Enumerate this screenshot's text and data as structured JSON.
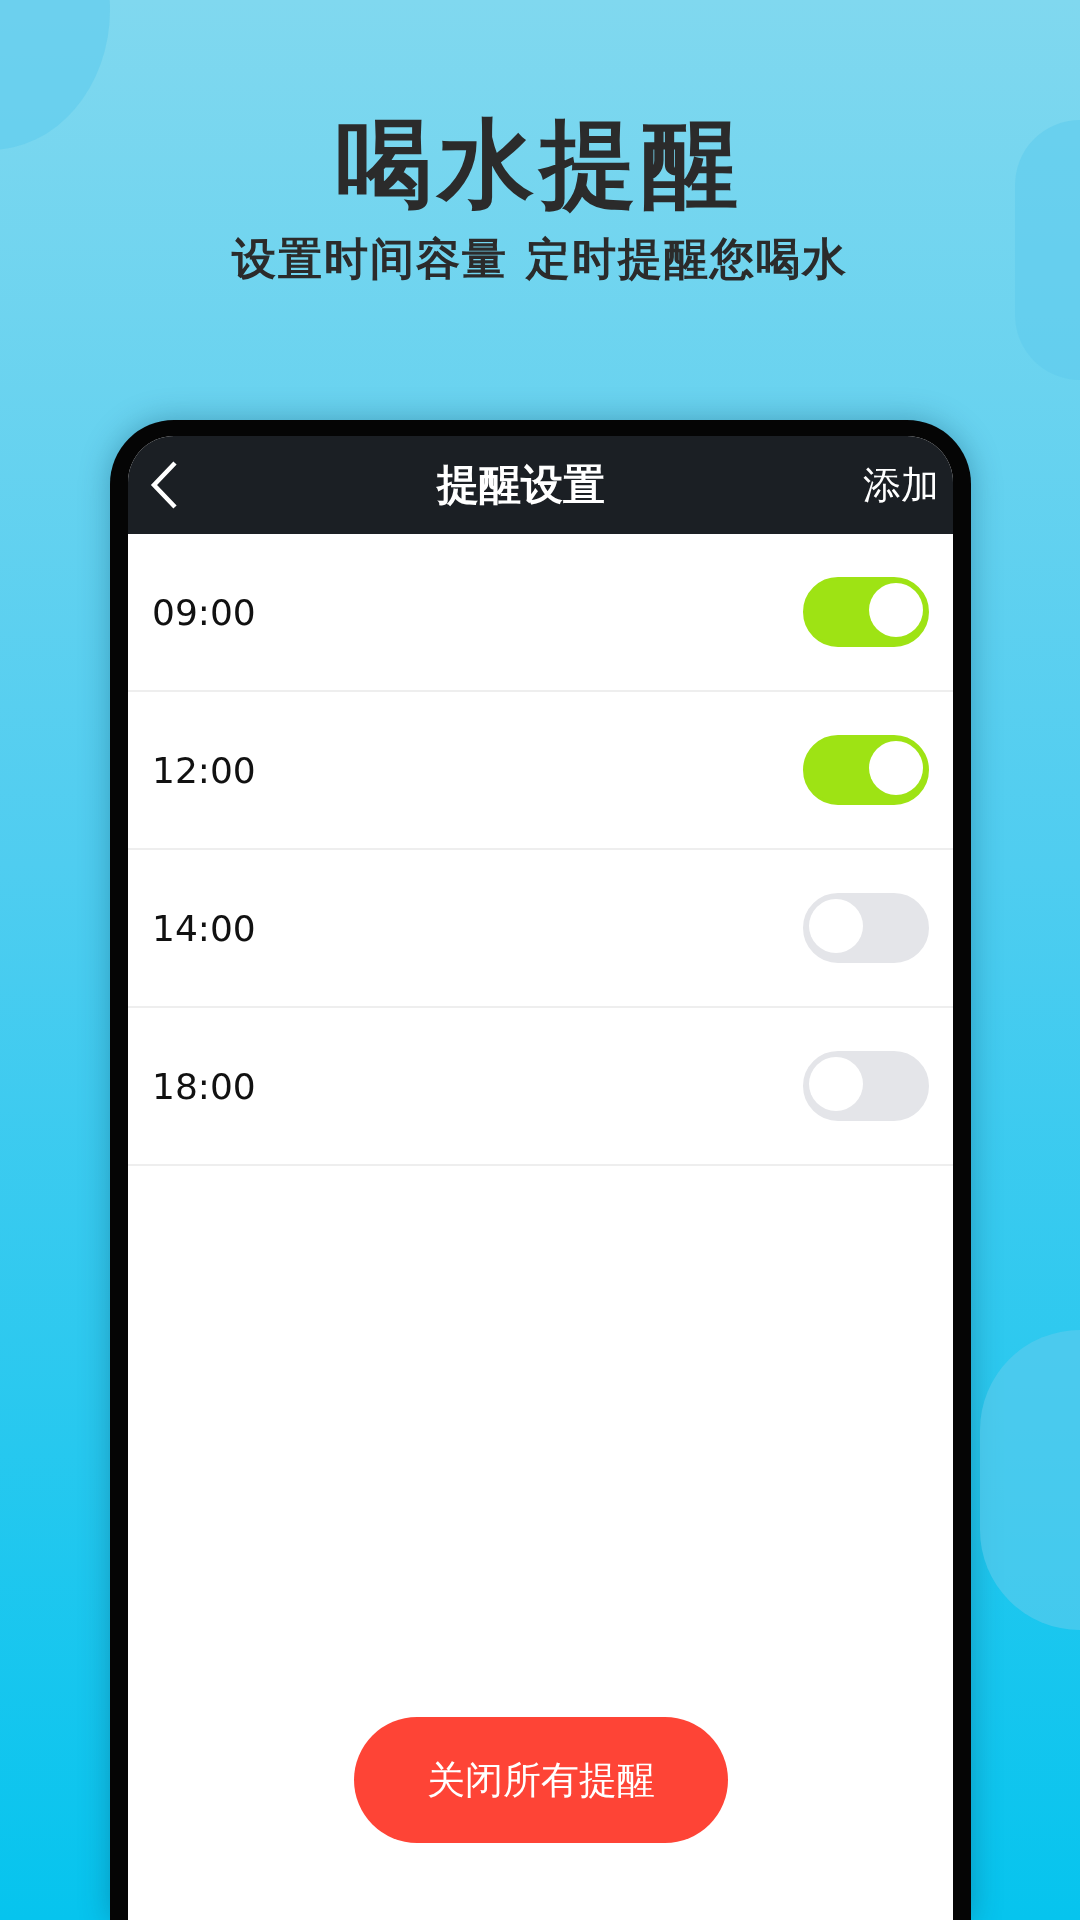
{
  "headline": "喝水提醒",
  "tagline": "设置时间容量 定时提醒您喝水",
  "screen": {
    "title": "提醒设置",
    "action": "添加",
    "reminders": [
      {
        "time": "09:00",
        "on": true
      },
      {
        "time": "12:00",
        "on": true
      },
      {
        "time": "14:00",
        "on": false
      },
      {
        "time": "18:00",
        "on": false
      }
    ],
    "button": "关闭所有提醒"
  }
}
